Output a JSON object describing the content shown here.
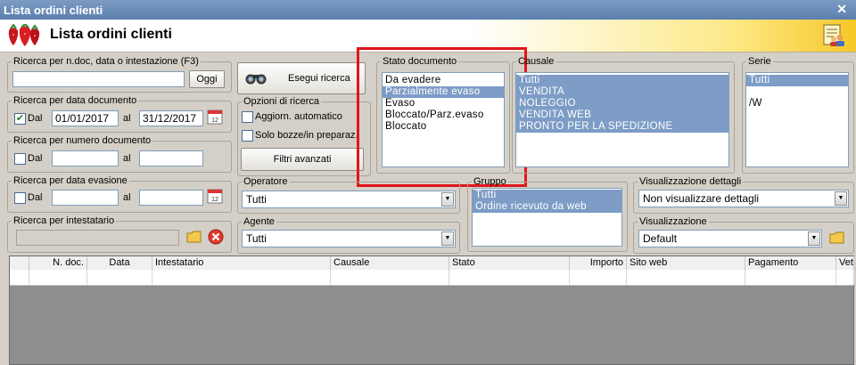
{
  "window": {
    "title": "Lista ordini clienti",
    "close_glyph": "✕"
  },
  "header": {
    "title": "Lista ordini clienti",
    "logo_icon": "strawberry-logo-icon",
    "right_icon": "users-list-icon"
  },
  "search_text": {
    "legend": "Ricerca per n.doc, data o intestazione (F3)",
    "value": "",
    "button": "Oggi"
  },
  "search_date_doc": {
    "legend": "Ricerca per data documento",
    "dal_label": "Dal",
    "al_label": "al",
    "from": "01/01/2017",
    "to": "31/12/2017",
    "checked": true
  },
  "search_num_doc": {
    "legend": "Ricerca per numero documento",
    "dal_label": "Dal",
    "al_label": "al",
    "from": "",
    "to": ""
  },
  "search_date_evas": {
    "legend": "Ricerca per data evasione",
    "dal_label": "Dal",
    "al_label": "al",
    "from": "",
    "to": ""
  },
  "search_owner": {
    "legend": "Ricerca per intestatario",
    "value": ""
  },
  "execute": {
    "label": "Esegui ricerca"
  },
  "search_options": {
    "legend": "Opzioni di ricerca",
    "auto_update": "Aggiorn. automatico",
    "drafts_only": "Solo bozze/in preparaz.",
    "advanced_filters": "Filtri avanzati"
  },
  "stato_documento": {
    "legend": "Stato documento",
    "items": [
      "Da evadere",
      "Parzialmente evaso",
      "Evaso",
      "Bloccato/Parz.evaso",
      "Bloccato"
    ],
    "selected": [
      1
    ]
  },
  "causale": {
    "legend": "Causale",
    "items": [
      "Tutti",
      "VENDITA",
      "NOLEGGIO",
      "VENDITA WEB",
      "PRONTO PER LA SPEDIZIONE"
    ],
    "selected": [
      0,
      1,
      2,
      3,
      4
    ]
  },
  "serie": {
    "legend": "Serie",
    "items": [
      "Tutti",
      "",
      "/W"
    ],
    "selected": [
      0
    ]
  },
  "operatore": {
    "legend": "Operatore",
    "value": "Tutti"
  },
  "agente": {
    "legend": "Agente",
    "value": "Tutti"
  },
  "gruppo": {
    "legend": "Gruppo",
    "items": [
      "Tutti",
      "Ordine ricevuto da web"
    ],
    "selected": [
      0,
      1
    ]
  },
  "vis_dettagli": {
    "legend": "Visualizzazione dettagli",
    "value": "Non visualizzare dettagli"
  },
  "visualizzazione": {
    "legend": "Visualizzazione",
    "value": "Default"
  },
  "table": {
    "columns": [
      "",
      "N. doc.",
      "Data",
      "Intestatario",
      "Causale",
      "Stato",
      "Importo",
      "Sito web",
      "Pagamento",
      "Vet"
    ]
  }
}
